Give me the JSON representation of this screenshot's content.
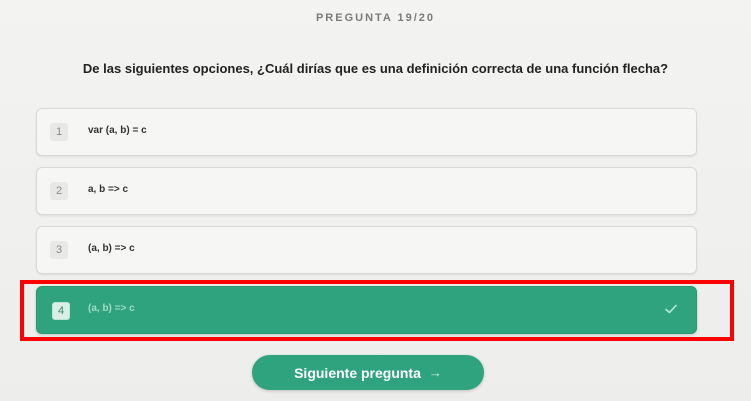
{
  "header": {
    "counter": "PREGUNTA 19/20"
  },
  "question": {
    "text": "De las siguientes opciones, ¿Cuál dirías que es una definición correcta de una función flecha?"
  },
  "options": [
    {
      "number": "1",
      "label": "var (a, b) = c"
    },
    {
      "number": "2",
      "label": "a, b => c"
    },
    {
      "number": "3",
      "label": "(a, b) => c"
    },
    {
      "number": "4",
      "label": "(a, b) => c",
      "selected": true
    }
  ],
  "footer": {
    "next_label": "Siguiente pregunta",
    "next_arrow": "→"
  },
  "colors": {
    "accent": "#2fa37d",
    "highlight": "#ff0000"
  },
  "icons": {
    "selected": "check-icon",
    "next": "arrow-right-icon"
  }
}
